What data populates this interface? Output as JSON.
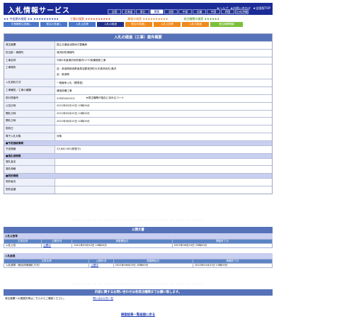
{
  "header": {
    "title": "入札情報サービス",
    "links": [
      "★ヘルプ",
      "★お問い合わせ",
      "★全国版TOP"
    ],
    "regions": [
      {
        "label": "全国",
        "active": false
      },
      {
        "label": "北海道",
        "active": false
      },
      {
        "label": "東北",
        "active": false
      },
      {
        "label": "関東",
        "active": true
      },
      {
        "label": "北陸",
        "active": false
      },
      {
        "label": "中部",
        "active": false
      },
      {
        "label": "近畿",
        "active": false
      },
      {
        "label": "中国",
        "active": false
      },
      {
        "label": "四国",
        "active": false
      },
      {
        "label": "九州/沖縄",
        "active": false
      }
    ]
  },
  "sections": {
    "organization": "★★ 中長期の検索 ★★ ★★★★★★★★★★",
    "construction": "工事の検索 ★★★★★★★★★★",
    "service": "業務の検索 ★★★★★★★★★★",
    "order": "発注機関の検索 ★★★★★★"
  },
  "tabs": [
    {
      "label": "中長期発注見通し",
      "style": "blue",
      "width": 50
    },
    {
      "label": "発注の見通し",
      "style": "blue",
      "width": 38
    },
    {
      "label": "入札公告等",
      "style": "blue",
      "width": 38
    },
    {
      "label": "入札の経過",
      "style": "navy",
      "width": 38
    },
    {
      "label": "発注の見通し",
      "style": "orange",
      "width": 38
    },
    {
      "label": "入札公告等",
      "style": "orange",
      "width": 38
    },
    {
      "label": "入札の経過",
      "style": "orange",
      "width": 38
    },
    {
      "label": "発注機関情報",
      "style": "green",
      "width": 46
    }
  ],
  "case": {
    "title": "入札の経過（工事）案件概要",
    "fields": [
      {
        "label": "発注機関",
        "value": "国土交通省北陸地方整備局"
      },
      {
        "label": "担当部・事務所",
        "value": "湯沢砂防事務所"
      },
      {
        "label": "工事名称",
        "value": "令和2年度湯沢砂防管内CCTV設備更新工事"
      },
      {
        "label": "工事場所",
        "value_lines": [
          "自：新潟県新潟県南魚沼郡湯沢町大字湯沢地先(湯沢",
          "至：新潟県"
        ],
        "tall": true
      },
      {
        "label": "入札契約方式",
        "value": "一般競争入札（標準型）"
      },
      {
        "label": "工事種別／工事の種類",
        "value": "通信設備工事"
      },
      {
        "label": "設計書番号",
        "value": "21R45401013",
        "note": "★発注機関が独自に定めるコード"
      },
      {
        "label": "公告日時",
        "value": "2021年05月19日 10時00分"
      },
      {
        "label": "開札日時",
        "value": "2021年05月20日 12時00分"
      },
      {
        "label": "開札日時",
        "value": "2021年06月15日 10時00分"
      },
      {
        "label": "契約日",
        "value": ""
      },
      {
        "label": "電子入札対象",
        "value": "対象"
      }
    ],
    "estimate_head": "■予定価格情報",
    "estimate": {
      "label": "予定価格",
      "value": "23,840,000(税抜き)"
    },
    "bidder_head": "■落札者情報",
    "bidder": [
      {
        "label": "落札者名",
        "value": ""
      },
      {
        "label": "落札価格",
        "value": ""
      }
    ],
    "contract_head": "■契約情報",
    "contract": [
      {
        "label": "契約者名",
        "value": ""
      },
      {
        "label": "契約金額",
        "value": ""
      }
    ]
  },
  "docs": {
    "title": "公開文書",
    "sections": [
      {
        "heading": "入札公告等",
        "columns": [
          "文書名称",
          "公開状況",
          "掲載開始日",
          "掲載終了日"
        ],
        "rows": [
          [
            "入札公告",
            "公開中",
            "2021年05月19日 10時00分",
            "2021年06月15日 23時00分"
          ]
        ]
      },
      {
        "heading": "入札経過",
        "columns": [
          "文書名称",
          "公開状況",
          "掲載開始日",
          "掲載終了日"
        ],
        "rows": [
          [
            "入札調書（総合評価落札方式）",
            "公開中",
            "2021年06月25日 10時00分",
            "2022年01月31日 23時00分"
          ]
        ]
      }
    ]
  },
  "contact": {
    "title": "内容に関するお問い合わせは各発注機関までお願い致します。",
    "text": "発注機関への連絡先等はこちらからご確認ください。",
    "link": "問い合わせ先一覧"
  },
  "back_link": "検索結果一覧画面に戻る"
}
